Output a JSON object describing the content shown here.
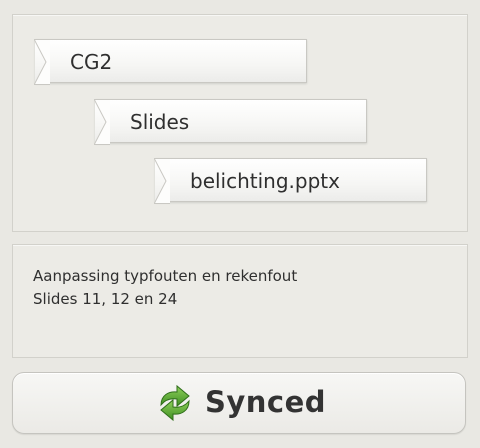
{
  "breadcrumb": {
    "items": [
      {
        "label": "CG2"
      },
      {
        "label": "Slides"
      },
      {
        "label": "belichting.pptx"
      }
    ]
  },
  "message": {
    "lines": [
      "Aanpassing typfouten en rekenfout",
      "Slides 11, 12 en 24"
    ]
  },
  "sync": {
    "label": "Synced",
    "icon": "sync-arrows-icon",
    "icon_color": "#4a9a2e",
    "status": "synced"
  }
}
